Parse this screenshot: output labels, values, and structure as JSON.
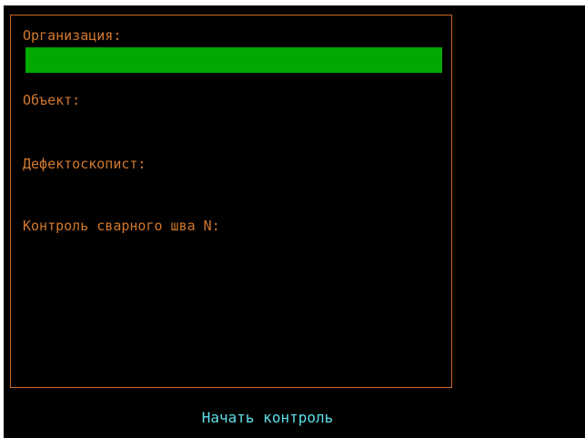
{
  "form": {
    "organization_label": "Организация:",
    "organization_value": "",
    "object_label": "Объект:",
    "object_value": "",
    "inspector_label": "Дефектоскопист:",
    "inspector_value": "",
    "weld_label": "Контроль сварного шва N:",
    "weld_value": ""
  },
  "actions": {
    "start_label": "Начать контроль"
  },
  "colors": {
    "background": "#000000",
    "label": "#d2782e",
    "border": "#c8692a",
    "active_field": "#00a800",
    "button_text": "#5fe0e8"
  }
}
